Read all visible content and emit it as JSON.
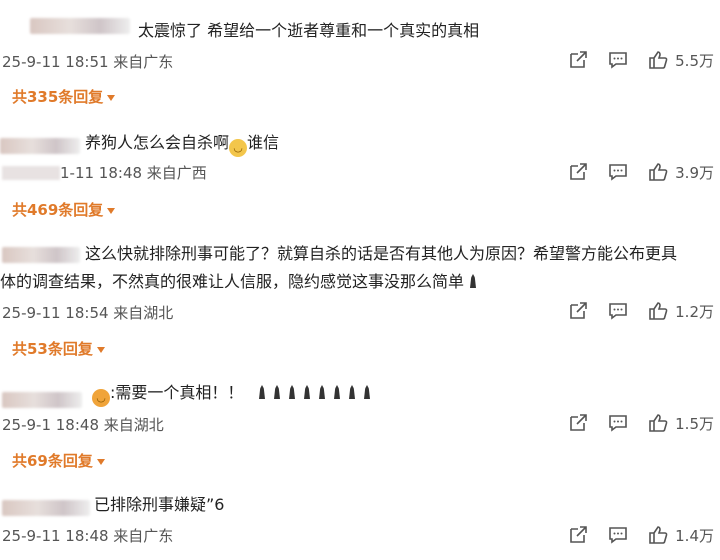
{
  "comments": [
    {
      "text": "太震惊了 希望给一个逝者尊重和一个真实的真相",
      "meta": "25-9-11 18:51 来自广东",
      "likes": "5.5万",
      "replies": "共335条回复"
    },
    {
      "text": "养狗人怎么会自杀啊",
      "text_suffix": "谁信",
      "meta": "1-11 18:48 来自广西",
      "likes": "3.9万",
      "replies": "共469条回复"
    },
    {
      "text": "这么快就排除刑事可能了？就算自杀的话是否有其他人为原因？希望警方能公布更具",
      "text_line2": "体的调查结果，不然真的很难让人信服，隐约感觉这事没那么简单",
      "meta": "25-9-11 18:54 来自湖北",
      "likes": "1.2万",
      "replies": "共53条回复"
    },
    {
      "text": ":需要一个真相！！",
      "meta": "25-9-1 18:48 来自湖北",
      "likes": "1.5万",
      "replies": "共69条回复"
    },
    {
      "text": "已排除刑事嫌疑”6",
      "meta": "25-9-11 18:48 来自广东",
      "likes": "1.4万"
    }
  ],
  "icons": {
    "share": "share-icon",
    "reply": "comment-icon",
    "like": "thumbs-up-icon",
    "emoji": "smile-emoji-icon",
    "figure": "candle-icon"
  },
  "colors": {
    "accent": "#e07a2a",
    "meta": "#555555"
  }
}
